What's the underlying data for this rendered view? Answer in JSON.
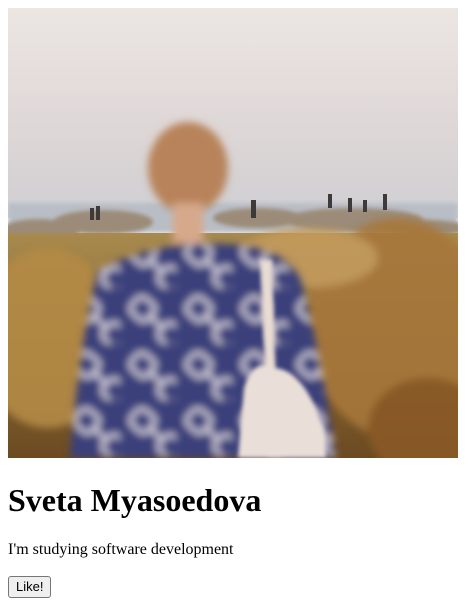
{
  "profile": {
    "photo_alt": "Sveta Myasoedova",
    "name": "Sveta Myasoedova",
    "bio": "I'm studying software development",
    "like_label": "Like!"
  }
}
